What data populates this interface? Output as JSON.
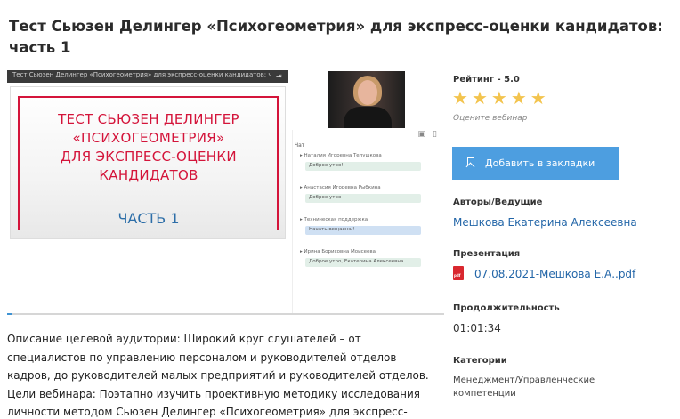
{
  "page": {
    "title": "Тест Сьюзен Делингер «Психогеометрия» для экспресс-оценки кандидатов: часть 1"
  },
  "player": {
    "topbar_title": "Тест Сьюзен Делингер «Психогеометрия» для экспресс-оценки кандидатов: ч...",
    "slide_lines": [
      "ТЕСТ СЬЮЗЕН ДЕЛИНГЕР",
      "«ПСИХОГЕОМЕТРИЯ»",
      "ДЛЯ ЭКСПРЕСС-ОЦЕНКИ",
      "КАНДИДАТОВ"
    ],
    "slide_part": "ЧАСТЬ 1",
    "progress_fraction": 0.01,
    "chat": {
      "tab": "Чат",
      "messages": [
        {
          "author": "Наталия Игоревна Телушкова",
          "text": "Доброе утро!",
          "highlight": false
        },
        {
          "author": "Анастасия Игоревна Рыбкина",
          "text": "Доброе утро",
          "highlight": false
        },
        {
          "author": "Техническая поддержка",
          "text": "Начать вещаешь!",
          "highlight": true
        },
        {
          "author": "Ирина Борисовна Моисеева",
          "text": "Доброе утро, Екатерина Алексеевна",
          "highlight": false
        }
      ]
    }
  },
  "description": "Описание целевой аудитории: Широкий круг слушателей – от специалистов по управлению персоналом и руководителей отделов кадров, до руководителей малых предприятий и руководителей отделов. Цели вебинара: Поэтапно изучить проективную методику исследования личности методом Сьюзен Делингер «Психогеометрия» для экспресс-оценки кандидатов.",
  "sidebar": {
    "rating_label": "Рейтинг - 5.0",
    "rating_value": 5,
    "rating_max": 5,
    "star_icon": "star-icon",
    "rate_link": "Оцените вебинар",
    "bookmark_button": "Добавить в закладки",
    "authors_label": "Авторы/Ведущие",
    "author_name": "Мешкова Екатерина Алексеевна",
    "presentation_label": "Презентация",
    "pdf_badge": "pdf",
    "presentation_file": "07.08.2021-Мешкова Е.А..pdf",
    "duration_label": "Продолжительность",
    "duration_value": "01:01:34",
    "category_label": "Категории",
    "category_value": "Менеджмент/Управленческие компетенции"
  },
  "colors": {
    "accent": "#4d9ee0",
    "link": "#2366a8",
    "star": "#f3c44e",
    "slide_red": "#d4143a",
    "slide_blue": "#2d6ea8"
  }
}
